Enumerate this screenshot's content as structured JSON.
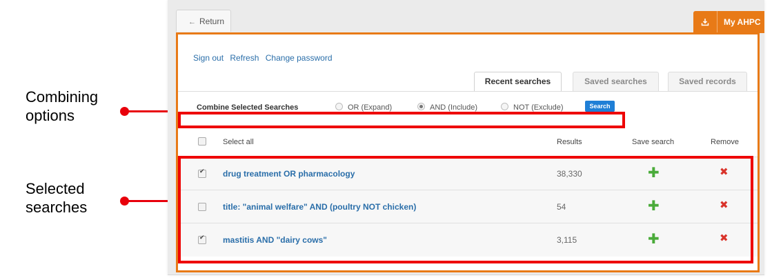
{
  "annotations": {
    "combining_label_line1": "Combining",
    "combining_label_line2": "options",
    "selected_label_line1": "Selected",
    "selected_label_line2": "searches",
    "highlight_color": "#ee0000"
  },
  "topbar": {
    "return_label": "Return",
    "return_icon": "arrow-left-icon",
    "my_label": "My AHPC",
    "my_icon": "download-icon",
    "accent_color": "#e87a17"
  },
  "links": [
    "Sign out",
    "Refresh",
    "Change password"
  ],
  "tabs": [
    {
      "label": "Recent searches",
      "active": true
    },
    {
      "label": "Saved searches",
      "active": false
    },
    {
      "label": "Saved records",
      "active": false
    }
  ],
  "combine": {
    "title": "Combine Selected Searches",
    "options": [
      {
        "label": "OR (Expand)",
        "selected": false
      },
      {
        "label": "AND (Include)",
        "selected": true
      },
      {
        "label": "NOT (Exclude)",
        "selected": false
      }
    ],
    "button_label": "Search"
  },
  "table": {
    "select_all_label": "Select all",
    "col_results": "Results",
    "col_save": "Save search",
    "col_remove": "Remove",
    "rows": [
      {
        "query": "drug treatment OR pharmacology",
        "results": "38,330",
        "checked": true
      },
      {
        "query": "title: \"animal welfare\" AND (poultry NOT chicken)",
        "results": "54",
        "checked": false
      },
      {
        "query": "mastitis AND \"dairy cows\"",
        "results": "3,115",
        "checked": true
      }
    ],
    "save_icon": "plus-icon",
    "remove_icon": "close-icon"
  }
}
